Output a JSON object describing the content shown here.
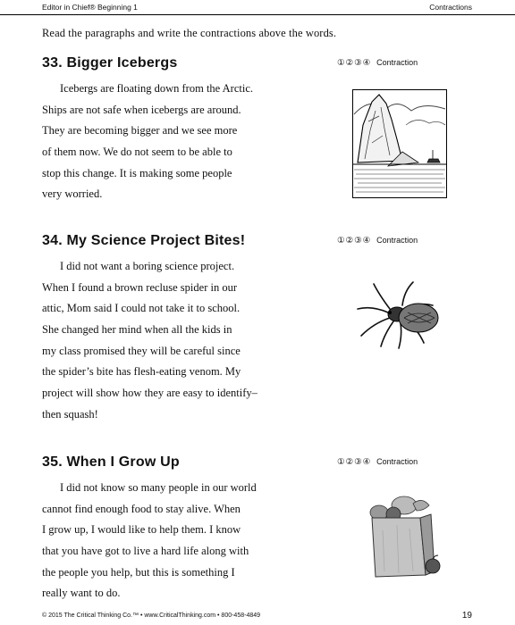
{
  "header": {
    "left": "Editor in Chief® Beginning 1",
    "right": "Contractions"
  },
  "instructions": "Read the paragraphs and write the contractions above the words.",
  "circle_labels": [
    "①",
    "②",
    "③",
    "④"
  ],
  "contraction_label": "Contraction",
  "exercises": [
    {
      "title": "33.  Bigger Icebergs",
      "lines": [
        "Icebergs are floating down from the Arctic.",
        "Ships are not safe when icebergs are around.",
        "They are becoming bigger and we see more",
        "of them now.  We do not seem to be able to",
        "stop this change.  It is making some people",
        "very worried."
      ],
      "image_icon": "iceberg-illustration"
    },
    {
      "title": "34.  My Science Project Bites!",
      "lines": [
        "I did not want a boring science project.",
        "When I found a brown recluse spider in our",
        "attic, Mom said I could not take it to school.",
        "She changed her mind when all the kids in",
        "my class promised they will be careful since",
        "the spider’s bite has flesh-eating venom.  My",
        "project will show how they are easy to identify–",
        "then squash!"
      ],
      "image_icon": "spider-illustration"
    },
    {
      "title": "35.  When I Grow Up",
      "lines": [
        "I did not know so many people in our world",
        "cannot find enough food to stay alive.  When",
        "I grow up, I would like to help them.  I know",
        "that you have got to live a hard life along with",
        "the people you help, but this is something I",
        "really want to do."
      ],
      "image_icon": "grocery-bag-illustration"
    }
  ],
  "footer": {
    "copyright": "© 2015 The Critical Thinking Co.™ • www.CriticalThinking.com • 800-458-4849",
    "page_number": "19"
  }
}
